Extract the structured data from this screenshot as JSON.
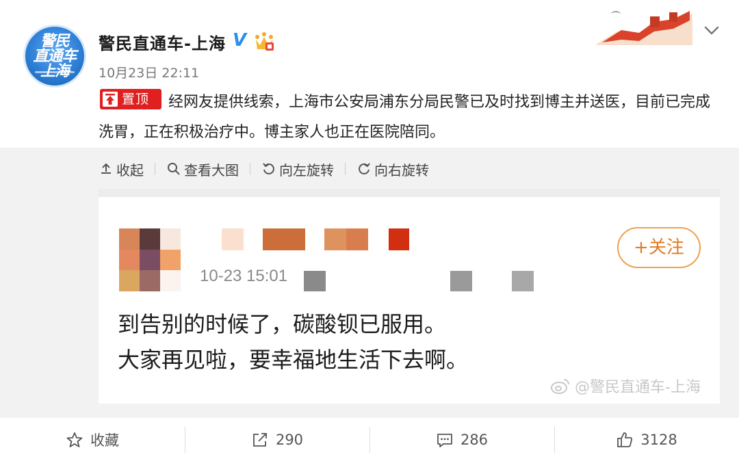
{
  "post": {
    "username": "警民直通车-上海",
    "verified_mark": "V",
    "avatar_text": "警民\n直通车\n上海",
    "timestamp": "10月23日 22:11",
    "pin_label": "置顶",
    "text": "经网友提供线索，上海市公安局浦东分局民警已及时找到博主并送医，目前已完成洗胃，正在积极治疗中。博主家人也正在医院陪同。"
  },
  "image_toolbar": {
    "collapse": "收起",
    "view_large": "查看大图",
    "rotate_left": "向左旋转",
    "rotate_right": "向右旋转"
  },
  "embedded_post": {
    "time": "10-23 15:01",
    "follow_label": "+关注",
    "text": "到告别的时候了，碳酸钡已服用。\n大家再见啦，要幸福地生活下去啊。",
    "watermark": "@警民直通车-上海"
  },
  "actions": {
    "favorite": "收藏",
    "repost_count": "290",
    "comment_count": "286",
    "like_count": "3128"
  },
  "colors": {
    "accent_blue": "#2b8ff0",
    "pin_red": "#e02020",
    "follow_orange": "#e07b20"
  }
}
